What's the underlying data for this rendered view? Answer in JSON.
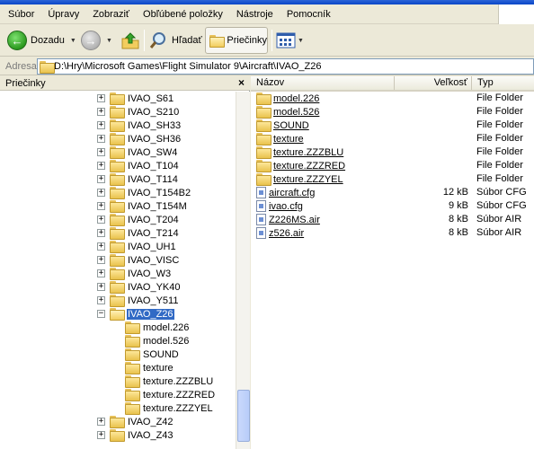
{
  "menu": [
    "Súbor",
    "Úpravy",
    "Zobraziť",
    "Obľúbené položky",
    "Nástroje",
    "Pomocník"
  ],
  "toolbar": {
    "back_label": "Dozadu",
    "search_label": "Hľadať",
    "folders_label": "Priečinky"
  },
  "address": {
    "label": "Adresa",
    "path": "D:\\Hry\\Microsoft Games\\Flight Simulator 9\\Aircraft\\IVAO_Z26"
  },
  "left_pane": {
    "title": "Priečinky",
    "close": "×",
    "tree": [
      {
        "label": "IVAO_S61",
        "expander": "+"
      },
      {
        "label": "IVAO_S210",
        "expander": "+"
      },
      {
        "label": "IVAO_SH33",
        "expander": "+"
      },
      {
        "label": "IVAO_SH36",
        "expander": "+"
      },
      {
        "label": "IVAO_SW4",
        "expander": "+"
      },
      {
        "label": "IVAO_T104",
        "expander": "+"
      },
      {
        "label": "IVAO_T114",
        "expander": "+"
      },
      {
        "label": "IVAO_T154B2",
        "expander": "+"
      },
      {
        "label": "IVAO_T154M",
        "expander": "+"
      },
      {
        "label": "IVAO_T204",
        "expander": "+"
      },
      {
        "label": "IVAO_T214",
        "expander": "+"
      },
      {
        "label": "IVAO_UH1",
        "expander": "+"
      },
      {
        "label": "IVAO_VISC",
        "expander": "+"
      },
      {
        "label": "IVAO_W3",
        "expander": "+"
      },
      {
        "label": "IVAO_YK40",
        "expander": "+"
      },
      {
        "label": "IVAO_Y511",
        "expander": "+"
      },
      {
        "label": "IVAO_Z26",
        "expander": "−",
        "selected": true
      },
      {
        "label": "model.226",
        "child": true
      },
      {
        "label": "model.526",
        "child": true
      },
      {
        "label": "SOUND",
        "child": true
      },
      {
        "label": "texture",
        "child": true
      },
      {
        "label": "texture.ZZZBLU",
        "child": true
      },
      {
        "label": "texture.ZZZRED",
        "child": true
      },
      {
        "label": "texture.ZZZYEL",
        "child": true
      },
      {
        "label": "IVAO_Z42",
        "expander": "+"
      },
      {
        "label": "IVAO_Z43",
        "expander": "+"
      }
    ]
  },
  "right_pane": {
    "columns": {
      "name": "Názov",
      "size": "Veľkosť",
      "type": "Typ"
    },
    "files": [
      {
        "name": "model.226",
        "size": "",
        "type": "File Folder",
        "kind": "folder"
      },
      {
        "name": "model.526",
        "size": "",
        "type": "File Folder",
        "kind": "folder"
      },
      {
        "name": "SOUND",
        "size": "",
        "type": "File Folder",
        "kind": "folder"
      },
      {
        "name": "texture",
        "size": "",
        "type": "File Folder",
        "kind": "folder"
      },
      {
        "name": "texture.ZZZBLU",
        "size": "",
        "type": "File Folder",
        "kind": "folder"
      },
      {
        "name": "texture.ZZZRED",
        "size": "",
        "type": "File Folder",
        "kind": "folder"
      },
      {
        "name": "texture.ZZZYEL",
        "size": "",
        "type": "File Folder",
        "kind": "folder"
      },
      {
        "name": "aircraft.cfg",
        "size": "12 kB",
        "type": "Súbor CFG",
        "kind": "file"
      },
      {
        "name": "ivao.cfg",
        "size": "9 kB",
        "type": "Súbor CFG",
        "kind": "file"
      },
      {
        "name": "Z226MS.air",
        "size": "8 kB",
        "type": "Súbor AIR",
        "kind": "file"
      },
      {
        "name": "z526.air",
        "size": "8 kB",
        "type": "Súbor AIR",
        "kind": "file"
      }
    ]
  },
  "colors": {
    "selection": "#316ac5",
    "folder": "#f2cd5e",
    "chrome": "#ece9d8"
  }
}
